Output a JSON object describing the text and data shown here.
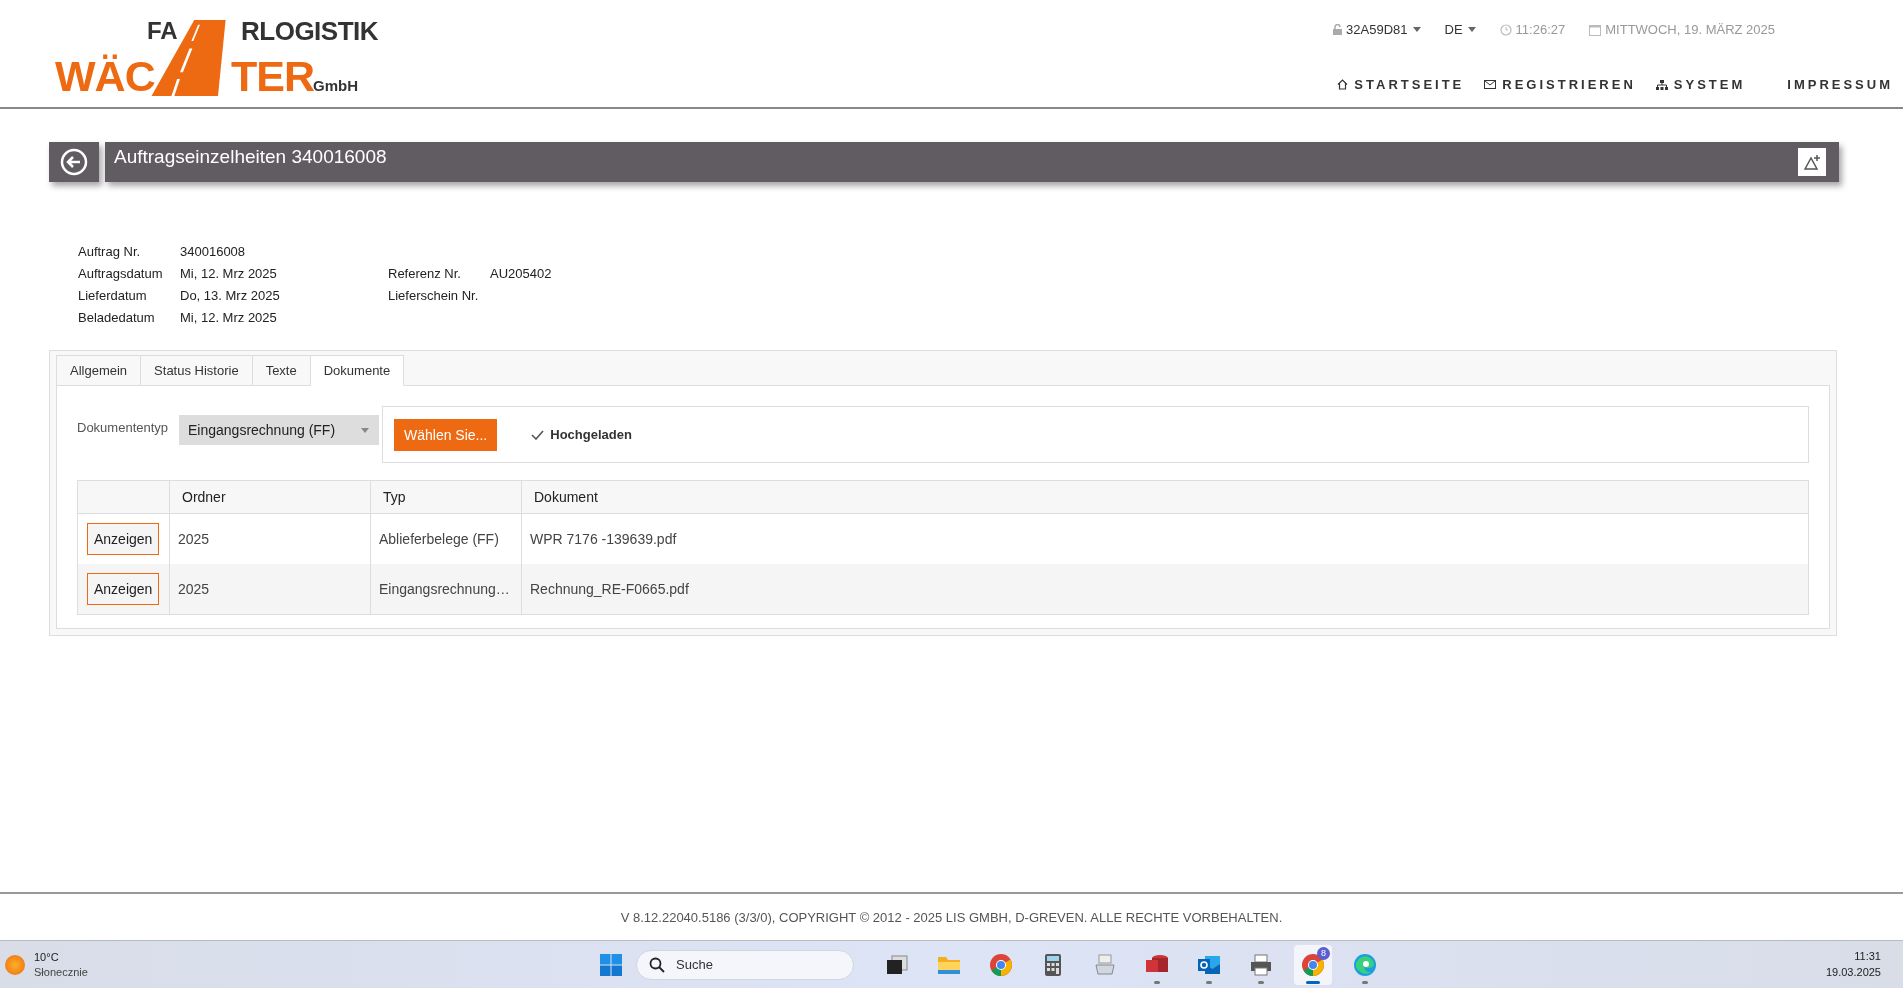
{
  "logo": {
    "top_left": "FA",
    "top_right": "RLOGISTIK",
    "bottom_left": "WÄC",
    "bottom_right": "TER",
    "suffix": "GmbH"
  },
  "topbar": {
    "user": "32A59D81",
    "language": "DE",
    "time": "11:26:27",
    "date": "MITTWOCH, 19. MÄRZ 2025"
  },
  "nav": [
    {
      "kind": "home",
      "label": "STARTSEITE"
    },
    {
      "kind": "mail",
      "label": "REGISTRIEREN"
    },
    {
      "kind": "network",
      "label": "SYSTEM"
    },
    {
      "kind": "none",
      "label": "IMPRESSUM"
    }
  ],
  "page": {
    "title": "Auftragseinzelheiten 340016008"
  },
  "details": {
    "left": [
      {
        "label": "Auftrag Nr.",
        "value": "340016008"
      },
      {
        "label": "Auftragsdatum",
        "value": "Mi, 12. Mrz 2025"
      },
      {
        "label": "Lieferdatum",
        "value": "Do, 13. Mrz 2025"
      },
      {
        "label": "Beladedatum",
        "value": "Mi, 12. Mrz 2025"
      }
    ],
    "right": [
      {
        "label": "Referenz Nr.",
        "value": "AU205402"
      },
      {
        "label": "Lieferschein Nr."
      }
    ]
  },
  "tabs": [
    {
      "label": "Allgemein",
      "selected": false
    },
    {
      "label": "Status Historie",
      "selected": false
    },
    {
      "label": "Texte",
      "selected": false
    },
    {
      "label": "Dokumente",
      "selected": true
    }
  ],
  "upload": {
    "type_label": "Dokumententyp",
    "type_value": "Eingangsrechnung (FF)",
    "button": "Wählen Sie...",
    "status": "Hochgeladen"
  },
  "table": {
    "columns": [
      "Ordner",
      "Typ",
      "Dokument"
    ],
    "rows": [
      {
        "action": "Anzeigen",
        "cells": [
          "2025",
          "Ablieferbelege (FF)",
          "WPR 7176 -139639.pdf"
        ]
      },
      {
        "action": "Anzeigen",
        "cells": [
          "2025",
          "Eingangsrechnung…",
          "Rechnung_RE-F0665.pdf"
        ]
      }
    ]
  },
  "footer": "V 8.12.22040.5186 (3/3/0), COPYRIGHT © 2012 - 2025 LIS GMBH, D-GREVEN. ALLE RECHTE VORBEHALTEN.",
  "taskbar": {
    "weather": {
      "temperature": "10°C",
      "condition": "Słonecznie"
    },
    "search": "Suche",
    "apps": [
      {
        "kind": "taskview",
        "running": false,
        "selected": false
      },
      {
        "kind": "folder",
        "running": false,
        "selected": false
      },
      {
        "kind": "chrome",
        "running": false,
        "selected": false
      },
      {
        "kind": "calculator",
        "running": false,
        "selected": false
      },
      {
        "kind": "scanner",
        "running": false,
        "selected": false
      },
      {
        "kind": "access",
        "running": true,
        "selected": false
      },
      {
        "kind": "outlook",
        "running": true,
        "selected": false
      },
      {
        "kind": "printer",
        "running": true,
        "selected": false
      },
      {
        "kind": "chrome",
        "running": true,
        "selected": true,
        "badge": "8"
      },
      {
        "kind": "edge",
        "running": true,
        "selected": false
      }
    ],
    "time": "11:31",
    "date": "19.03.2025"
  }
}
